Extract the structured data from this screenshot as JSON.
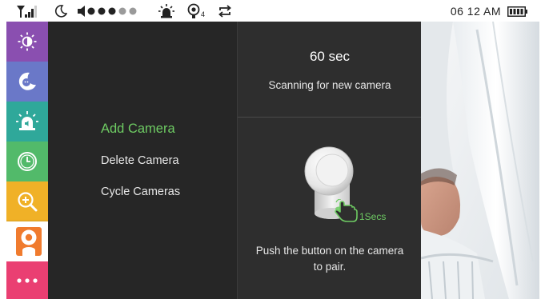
{
  "status_bar": {
    "time": "06  12 AM",
    "icons": [
      "signal-icon",
      "moon-icon",
      "volume-level-icon",
      "alarm-light-icon",
      "temperature-sensor-icon",
      "cycle-icon",
      "battery-icon"
    ],
    "temperature_sensor_sub": "4",
    "volume_level": 3,
    "volume_max": 6
  },
  "sidebar": {
    "items": [
      {
        "icon": "brightness-icon",
        "color": "#8a4fb0"
      },
      {
        "icon": "night-mode-icon",
        "color": "#6a78c8"
      },
      {
        "icon": "alarm-icon",
        "color": "#2fa89a"
      },
      {
        "icon": "clock-icon",
        "color": "#52ba6a"
      },
      {
        "icon": "zoom-in-icon",
        "color": "#f0b127"
      },
      {
        "icon": "camera-icon",
        "color": "#f07b2e",
        "active": true
      },
      {
        "icon": "more-icon",
        "color": "#ea3f72"
      }
    ]
  },
  "menu": {
    "items": [
      {
        "label": "Add Camera",
        "selected": true
      },
      {
        "label": "Delete Camera"
      },
      {
        "label": "Cycle Cameras"
      }
    ]
  },
  "pairing": {
    "countdown": "60 sec",
    "status": "Scanning for new camera",
    "press_duration": "1Secs",
    "instruction": "Push the button on the camera to pair."
  },
  "colors": {
    "accent": "#6ecb63",
    "panel": "#2e2e2e",
    "menu": "#262626"
  }
}
